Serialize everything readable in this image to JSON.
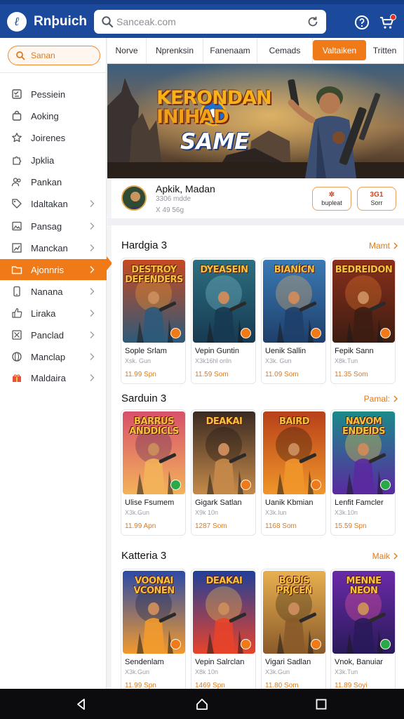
{
  "header": {
    "app_name": "Rnþuich",
    "search_placeholder": "Sanceak.com",
    "icons": [
      "brand-logo-icon",
      "search-icon",
      "refresh-icon",
      "help-icon",
      "cart-icon"
    ]
  },
  "sidebar": {
    "search_label": "Sanan",
    "items": [
      {
        "label": "Pessiein",
        "icon": "checklist-icon",
        "chevron": false,
        "active": false
      },
      {
        "label": "Aoking",
        "icon": "bag-icon",
        "chevron": false,
        "active": false
      },
      {
        "label": "Joirenes",
        "icon": "star-icon",
        "chevron": false,
        "active": false
      },
      {
        "label": "Jpklia",
        "icon": "puzzle-icon",
        "chevron": false,
        "active": false
      },
      {
        "label": "Pankan",
        "icon": "people-icon",
        "chevron": false,
        "active": false
      },
      {
        "label": "Idaltakan",
        "icon": "tag-icon",
        "chevron": true,
        "active": false
      },
      {
        "label": "Pansag",
        "icon": "image-icon",
        "chevron": true,
        "active": false
      },
      {
        "label": "Manckan",
        "icon": "chart-icon",
        "chevron": true,
        "active": false
      },
      {
        "label": "Ajonnris",
        "icon": "folder-icon",
        "chevron": true,
        "active": true
      },
      {
        "label": "Nanana",
        "icon": "phone-icon",
        "chevron": true,
        "active": false
      },
      {
        "label": "Liraka",
        "icon": "thumb-icon",
        "chevron": true,
        "active": false
      },
      {
        "label": "Panclad",
        "icon": "grid-icon",
        "chevron": true,
        "active": false
      },
      {
        "label": "Manclap",
        "icon": "globe-icon",
        "chevron": true,
        "active": false
      },
      {
        "label": "Maldaira",
        "icon": "gift-icon",
        "chevron": true,
        "active": false
      }
    ]
  },
  "tabs": [
    {
      "label": "Norve",
      "active": false
    },
    {
      "label": "Nprenksin",
      "active": false
    },
    {
      "label": "Fanenaam",
      "active": false
    },
    {
      "label": "Cemads",
      "active": false
    },
    {
      "label": "Valtaiken",
      "active": true
    },
    {
      "label": "Tritten",
      "active": false
    }
  ],
  "banner": {
    "line1": "KERONDAN",
    "line2": "INIHAD",
    "line3": "SAME"
  },
  "profile": {
    "name": "Apkik, Madan",
    "line1": "3306 mdde",
    "line2": "X 49 56g",
    "button1": {
      "icon_text": "✲",
      "label": "bupleat"
    },
    "button2": {
      "icon_text": "3G1",
      "label": "Sorr"
    }
  },
  "sections": [
    {
      "title": "Hardgia 3",
      "more": "Mamt",
      "cards": [
        {
          "thumb_text": "DESTROY DEFENDERS",
          "name": "Sople Srlam",
          "sub": "Xsk. Gun",
          "price": "11.99  Spn",
          "palette": [
            "#c64a22",
            "#2d5a7a",
            "#f29a2d"
          ],
          "badge": "orange"
        },
        {
          "thumb_text": "DYEASEIN",
          "name": "Vepin Guntin",
          "sub": "X3k16hl oriln",
          "price": "11.59  Som",
          "palette": [
            "#2c6e7f",
            "#173a52",
            "#7dbfcf"
          ],
          "badge": "orange"
        },
        {
          "thumb_text": "BIANÍCN",
          "name": "Uenik Sallin",
          "sub": "X3k. Gun",
          "price": "11.09  Som",
          "palette": [
            "#3a7ab5",
            "#1e3f6a",
            "#e8b36a"
          ],
          "badge": "orange"
        },
        {
          "thumb_text": "BEDREIDON",
          "name": "Fepik Sann",
          "sub": "X8k.Tun",
          "price": "11.35  Som",
          "palette": [
            "#8a2f1b",
            "#3d1d12",
            "#e0792a"
          ],
          "badge": "orange"
        }
      ]
    },
    {
      "title": "Sarduin 3",
      "more": "Pamal:",
      "cards": [
        {
          "thumb_text": "BARRUS ANDDICLS",
          "name": "Ulise Fsumem",
          "sub": "X3k.Gun",
          "price": "11.99  Apn",
          "palette": [
            "#d8506a",
            "#f3b35a",
            "#5b2a55"
          ],
          "badge": "green"
        },
        {
          "thumb_text": "DEAKAI",
          "name": "Gigark Satlan",
          "sub": "X9k 10n",
          "price": "1287  Som",
          "palette": [
            "#3a2a22",
            "#c58a4a",
            "#1d1410"
          ],
          "badge": "orange"
        },
        {
          "thumb_text": "BAIRD",
          "name": "Uanik Kbmian",
          "sub": "X3k.Iun",
          "price": "1168  Som",
          "palette": [
            "#b8401a",
            "#f0962a",
            "#2a1608"
          ],
          "badge": "orange"
        },
        {
          "thumb_text": "NAVOM ENDEIDS",
          "name": "Lenfit Famcler",
          "sub": "X3k.10n",
          "price": "15.59  Spn",
          "palette": [
            "#1b8a8a",
            "#5a2aa0",
            "#f0d23a"
          ],
          "badge": "green"
        }
      ]
    },
    {
      "title": "Katteria 3",
      "more": "Maik",
      "cards": [
        {
          "thumb_text": "VOONAI VCONEN",
          "name": "Sendenlam",
          "sub": "X3k.Gun",
          "price": "11.99  Spn",
          "palette": [
            "#2a4aa8",
            "#f29a2d",
            "#152250"
          ],
          "badge": "orange"
        },
        {
          "thumb_text": "DEAKAI",
          "name": "Vepin Salrclan",
          "sub": "X8k 10n",
          "price": "1469  Spn",
          "palette": [
            "#1f3f9a",
            "#e8432a",
            "#f7c64a"
          ],
          "badge": "orange"
        },
        {
          "thumb_text": "BODIS PRJCEN",
          "name": "Vigari Sadlan",
          "sub": "X3k.Gun",
          "price": "11.80  Som",
          "palette": [
            "#e8b050",
            "#8a5a2a",
            "#3a2a18"
          ],
          "badge": "orange"
        },
        {
          "thumb_text": "MENNE NEON",
          "name": "Vnok, Banuiar",
          "sub": "X3k.Tun",
          "price": "11.89  Soyi",
          "palette": [
            "#6a2aa8",
            "#2a1a5a",
            "#f05aa0"
          ],
          "badge": "green"
        }
      ]
    }
  ],
  "navbar": {
    "icons": [
      "back-icon",
      "home-icon",
      "recents-icon"
    ]
  },
  "colors": {
    "header": "#1b4a9c",
    "accent": "#ef7a17",
    "navbar": "#0c0c0e"
  }
}
